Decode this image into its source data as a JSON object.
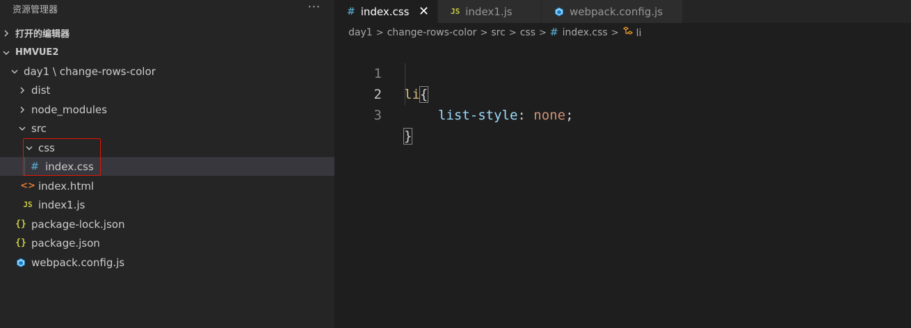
{
  "explorer": {
    "title": "资源管理器",
    "more": "···",
    "open_editors": "打开的编辑器",
    "workspace": "HMVUE2",
    "tree": [
      {
        "label": "day1 \\ change-rows-color",
        "type": "folder",
        "expanded": true
      },
      {
        "label": "dist",
        "type": "folder",
        "expanded": false
      },
      {
        "label": "node_modules",
        "type": "folder",
        "expanded": false
      },
      {
        "label": "src",
        "type": "folder",
        "expanded": true
      },
      {
        "label": "css",
        "type": "folder",
        "expanded": true
      },
      {
        "label": "index.css",
        "type": "css",
        "icon_text": "#"
      },
      {
        "label": "index.html",
        "type": "html",
        "icon_text": "<>"
      },
      {
        "label": "index1.js",
        "type": "js",
        "icon_text": "JS"
      },
      {
        "label": "package-lock.json",
        "type": "json",
        "icon_text": "{}"
      },
      {
        "label": "package.json",
        "type": "json",
        "icon_text": "{}"
      },
      {
        "label": "webpack.config.js",
        "type": "webpack"
      }
    ]
  },
  "tabs": [
    {
      "label": "index.css",
      "icon_text": "#",
      "active": true,
      "close": "✕"
    },
    {
      "label": "index1.js",
      "icon_text": "JS",
      "active": false
    },
    {
      "label": "webpack.config.js",
      "active": false
    }
  ],
  "breadcrumbs": {
    "items": [
      "day1",
      "change-rows-color",
      "src",
      "css"
    ],
    "file_icon": "#",
    "file": "index.css",
    "symbol": "li",
    "separator": ">"
  },
  "code": {
    "line_numbers": [
      "1",
      "2",
      "3"
    ],
    "selector": "li",
    "open_brace": "{",
    "property": "list-style",
    "colon": ":",
    "value": "none",
    "semicolon": ";",
    "close_brace": "}"
  },
  "colors": {
    "highlight_box": "#e51400",
    "css_icon": "#519aba",
    "js_icon": "#cbcb41",
    "html_icon": "#e37933",
    "selector": "#d7ba7d",
    "property": "#9cdcfe",
    "value": "#ce9178"
  }
}
